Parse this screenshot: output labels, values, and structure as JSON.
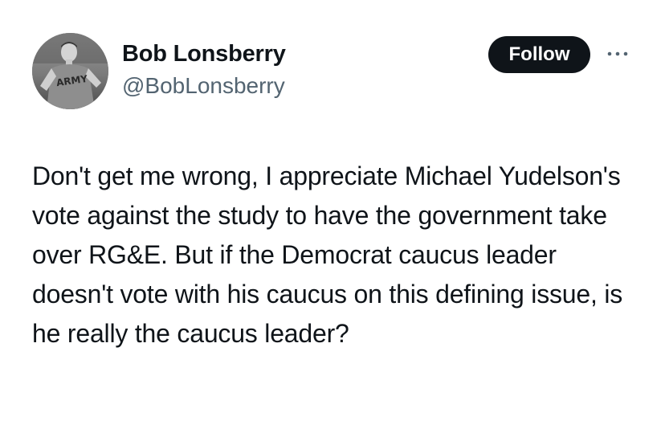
{
  "post": {
    "author_name": "Bob Lonsberry",
    "author_handle": "@BobLonsberry",
    "avatar_text": "ARMY",
    "follow_label": "Follow",
    "more_icon": "more-horizontal-icon",
    "text": "Don't get me wrong, I appreciate Michael Yudelson's vote against the study to have the government take over RG&E. But if the Democrat caucus leader doesn't vote with his caucus on this defining issue, is he really the caucus leader?"
  },
  "colors": {
    "text": "#0f1419",
    "secondary": "#536471",
    "button_bg": "#0f1419",
    "button_text": "#ffffff",
    "background": "#ffffff"
  }
}
